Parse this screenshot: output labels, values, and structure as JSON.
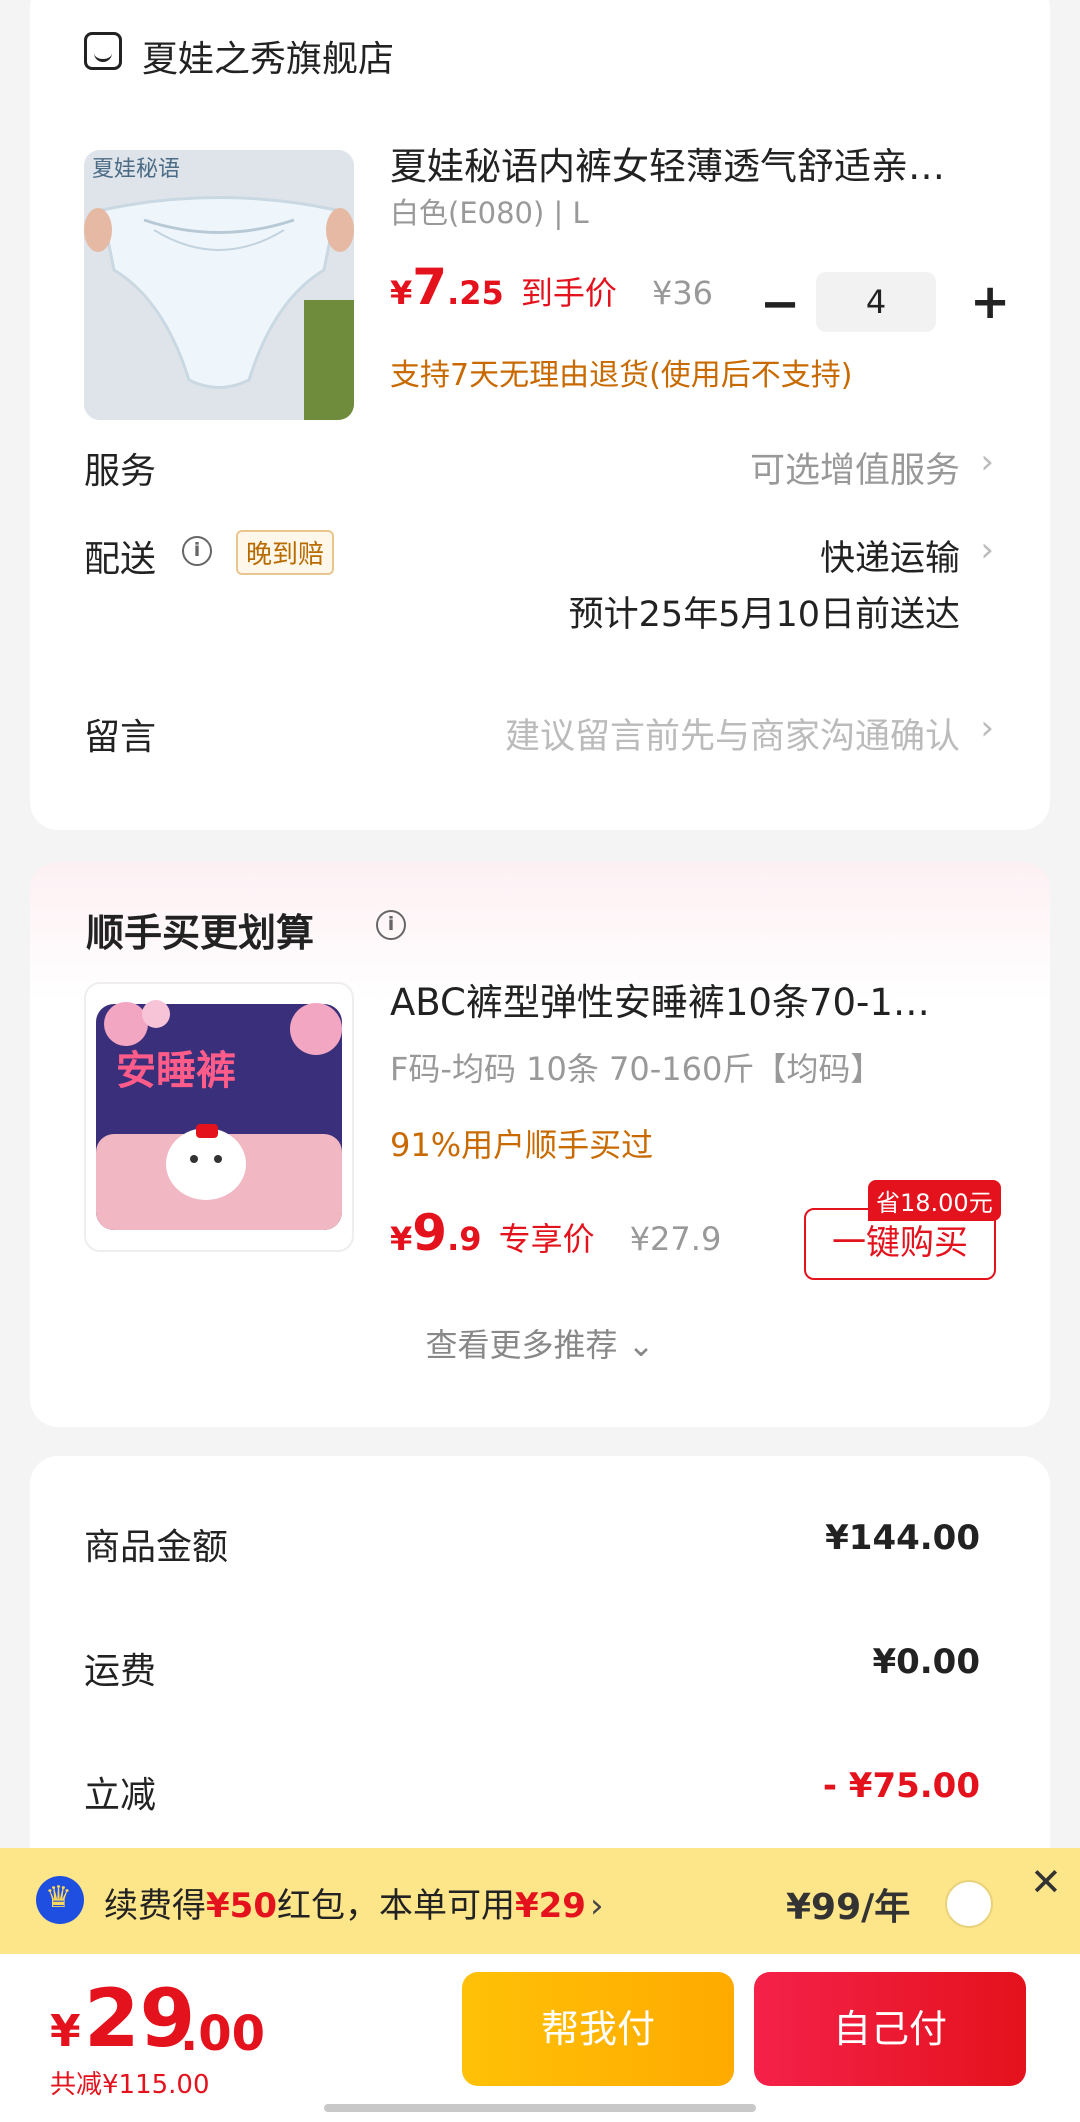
{
  "store": {
    "name": "夏娃之秀旗舰店",
    "product": {
      "thumb_brand": "夏娃秘语",
      "title": "夏娃秘语内裤女轻薄透气舒适亲…",
      "variant": "白色(E080) | L",
      "price_yen": "¥",
      "price_int": "7",
      "price_dec": ".25",
      "price_label": "到手价",
      "original_price": "¥36",
      "quantity": "4",
      "minus_label": "−",
      "plus_label": "+",
      "return_policy": "支持7天无理由退货(使用后不支持)"
    },
    "service": {
      "label": "服务",
      "value": "可选增值服务"
    },
    "delivery": {
      "label": "配送",
      "badge": "晚到赔",
      "method": "快递运输",
      "eta": "预计25年5月10日前送达"
    },
    "message": {
      "label": "留言",
      "placeholder": "建议留言前先与商家沟通确认"
    },
    "chevron": "›"
  },
  "recommend": {
    "title": "顺手买更划算",
    "item": {
      "thumb_text": "安睡裤",
      "title": "ABC裤型弹性安睡裤10条70-1…",
      "variant": "F码-均码 10条 70-160斤【均码】",
      "social": "91%用户顺手买过",
      "price_yen": "¥",
      "price_int": "9",
      "price_dec": ".9",
      "price_label": "专享价",
      "original_price": "¥27.9",
      "save_badge": "省18.00元",
      "buy_button": "一键购买"
    },
    "more_link": "查看更多推荐 ⌄"
  },
  "summary": {
    "rows": [
      {
        "label": "商品金额",
        "value": "¥144.00"
      },
      {
        "label": "运费",
        "value": "¥0.00"
      },
      {
        "label": "立减",
        "value": "- ¥75.00"
      }
    ]
  },
  "promo": {
    "text_1": "续费得",
    "amount_1": "¥50",
    "text_2": "红包，本单可用",
    "amount_2": "¥29",
    "arrow": "›",
    "price": "¥99/年",
    "close": "✕"
  },
  "bottom": {
    "total_yen": "¥",
    "total_int": "29",
    "total_dec": ".00",
    "total_saved": "共减¥115.00",
    "help_pay": "帮我付",
    "self_pay": "自己付"
  },
  "colors": {
    "accent_red": "#e4121c",
    "accent_orange": "#c86a00",
    "promo_yellow": "#fde58a",
    "help_pay_yellow": "#ffc107"
  }
}
